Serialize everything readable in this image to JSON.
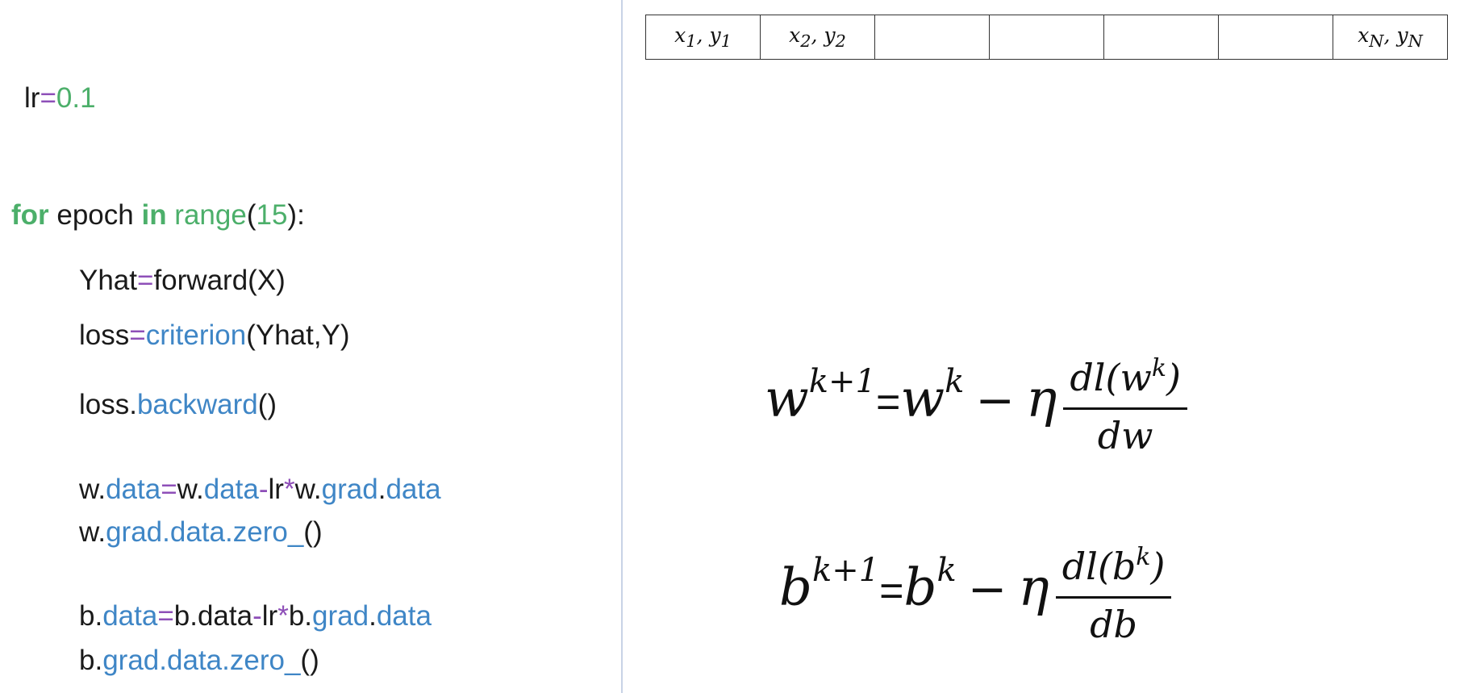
{
  "code": {
    "lr_line": {
      "name": "lr",
      "op": "=",
      "value": "0.1"
    },
    "for_line": {
      "kw_for": "for",
      "var": " epoch ",
      "kw_in": "in",
      "fn": " range",
      "open": "(",
      "num": "15",
      "close": "):"
    },
    "yhat_line": {
      "lhs": "Yhat",
      "op": "=",
      "rhs": "forward(X)"
    },
    "loss_line": {
      "lhs": "loss",
      "op": "=",
      "fn": "criterion",
      "args": "(Yhat,Y)"
    },
    "backward_line": {
      "obj": "loss.",
      "fn": "backward",
      "paren": "()"
    },
    "w_update": {
      "p1": "w.",
      "a1": "data",
      "op1": "=",
      "p2": "w.",
      "a2": "data",
      "op2": "-",
      "p3": "lr",
      "op3": "*",
      "p4": "w.",
      "a3": "grad",
      "dot": ".",
      "a4": "data"
    },
    "w_zero": {
      "p1": "w.",
      "a1": "grad",
      "d1": ".",
      "a2": "data",
      "d2": ".",
      "a3": "zero_",
      "paren": "()"
    },
    "b_update": {
      "p1": "b.",
      "a1": "data",
      "op1": "=",
      "p2": "b.data",
      "op2": "-",
      "p3": "lr",
      "op3": "*",
      "p4": "b.",
      "a3": "grad",
      "dot": ".",
      "a4": "data"
    },
    "b_zero": {
      "p1": "b.",
      "a1": "grad",
      "d1": ".",
      "a2": "data",
      "d2": ".",
      "a3": "zero_",
      "paren": "()"
    }
  },
  "table": {
    "cells": [
      {
        "x": "x",
        "xs": "1",
        "y": "y",
        "ys": "1"
      },
      {
        "x": "x",
        "xs": "2",
        "y": "y",
        "ys": "2"
      },
      null,
      null,
      null,
      null,
      {
        "x": "x",
        "xs": "N",
        "y": "y",
        "ys": "N"
      }
    ]
  },
  "equations": {
    "w": {
      "var": "w",
      "sup": "k+1",
      "eq": "=",
      "rhs_var": "w",
      "rhs_sup": "k",
      "minus": "−",
      "eta": "η",
      "num_pre": "dl(w",
      "num_sup": "k",
      "num_post": ")",
      "den": "dw"
    },
    "b": {
      "var": "b",
      "sup": "k+1",
      "eq": "=",
      "rhs_var": "b",
      "rhs_sup": "k",
      "minus": "−",
      "eta": "η",
      "num_pre": "dl(b",
      "num_sup": "k",
      "num_post": ")",
      "den": "db"
    }
  },
  "colors": {
    "keyword": "#4caf6a",
    "number": "#4caf6a",
    "operator": "#8e4fb8",
    "function": "#3f86c6",
    "divider": "#c8d3e6"
  }
}
